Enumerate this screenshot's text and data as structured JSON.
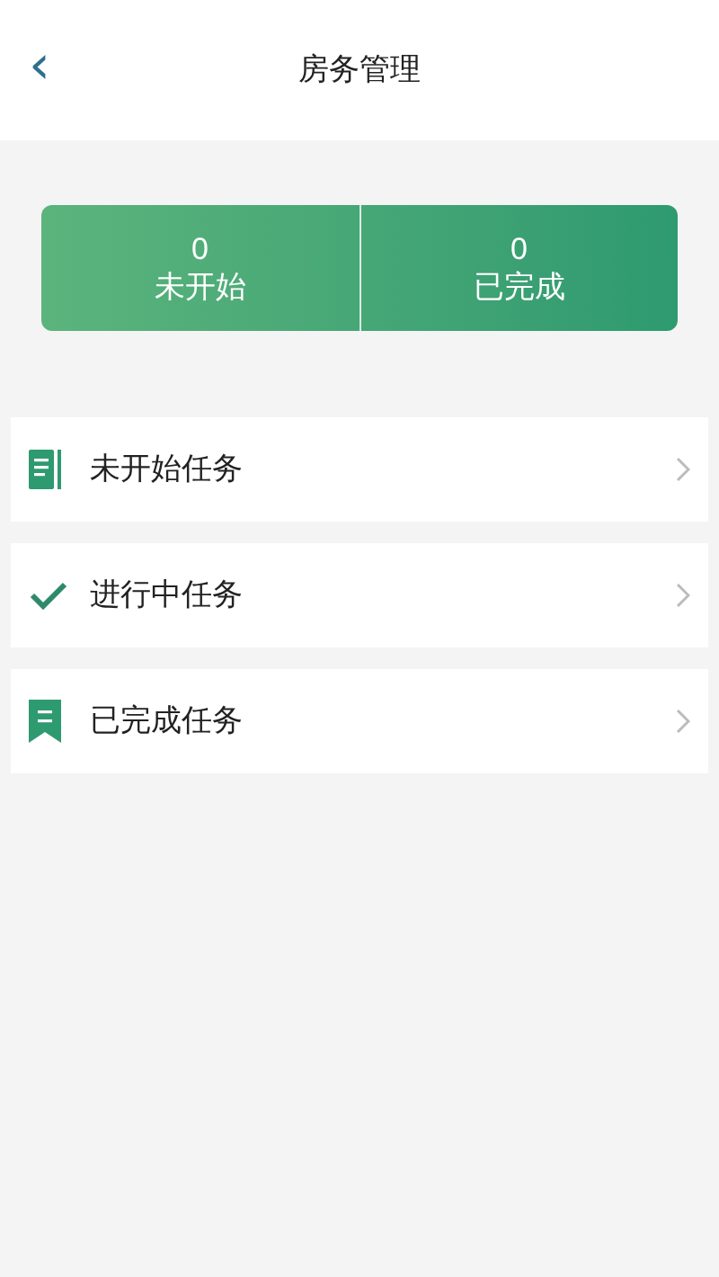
{
  "header": {
    "back": "‹",
    "title": "房务管理"
  },
  "stats": [
    {
      "count": "0",
      "label": "未开始"
    },
    {
      "count": "0",
      "label": "已完成"
    }
  ],
  "tasks": [
    {
      "kind": "document",
      "label": "未开始任务"
    },
    {
      "kind": "check",
      "label": "进行中任务"
    },
    {
      "kind": "bookmark",
      "label": "已完成任务"
    }
  ]
}
